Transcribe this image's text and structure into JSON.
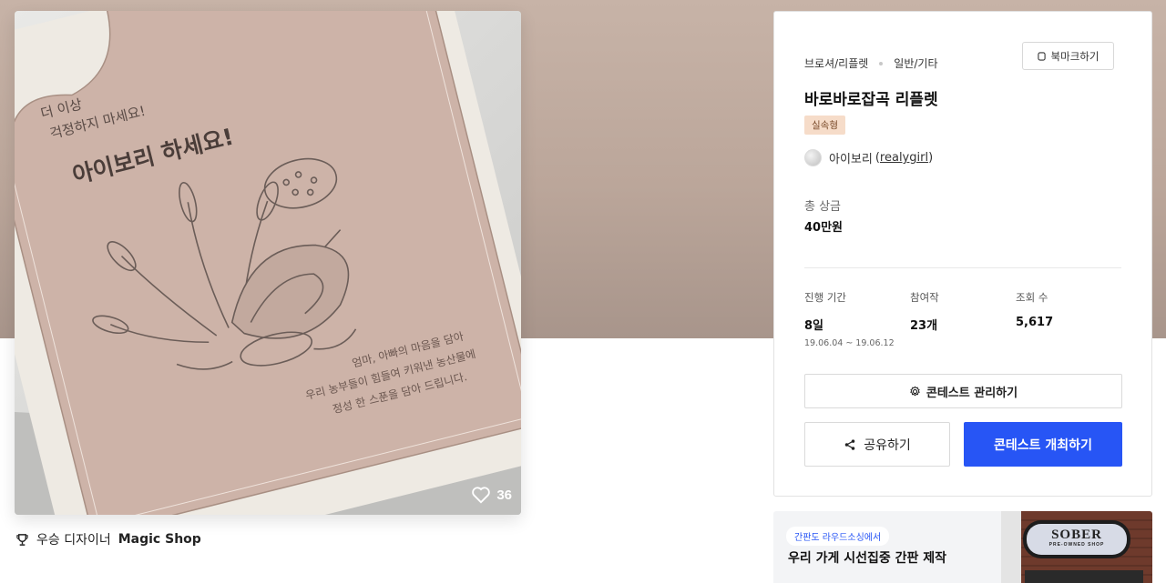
{
  "artwork": {
    "headline_small": [
      "더 이상",
      "걱정하지 마세요!"
    ],
    "headline_big": "아이보리 하세요!",
    "body_lines": [
      "엄마, 아빠의 마음을 담아",
      "우리 농부들이 힘들여 키워낸 농산물에",
      "정성 한 스푼을 담아 드립니다."
    ]
  },
  "gallery": {
    "like_count": "36",
    "award_prefix": "우승 디자이너",
    "award_name": "Magic Shop"
  },
  "contest": {
    "category": "브로셔/리플렛",
    "subcategory": "일반/기타",
    "bookmark_label": "북마크하기",
    "title": "바로바로잡곡 리플렛",
    "tag": "실속형",
    "author_name": "아이보리",
    "author_handle": "realygirl",
    "prize_label": "총 상금",
    "prize_value": "40만원",
    "stats": {
      "period_label": "진행 기간",
      "period_value": "8일",
      "period_dates": "19.06.04 ~ 19.06.12",
      "entries_label": "참여작",
      "entries_value": "23개",
      "views_label": "조회 수",
      "views_value": "5,617"
    },
    "manage_label": "콘테스트 관리하기",
    "share_label": "공유하기",
    "host_label": "콘테스트 개최하기"
  },
  "banner": {
    "pill_text": "간판도 라우드소싱에서",
    "title": "우리 가게 시선집중 간판 제작",
    "brand_text": "SOBER",
    "brand_sub": "PRE-OWNED SHOP"
  },
  "colors": {
    "accent": "#2755f5",
    "tag_bg": "#f6dcc9",
    "hero_bg": "#c0aca0",
    "paper": "#cdb3a8"
  }
}
